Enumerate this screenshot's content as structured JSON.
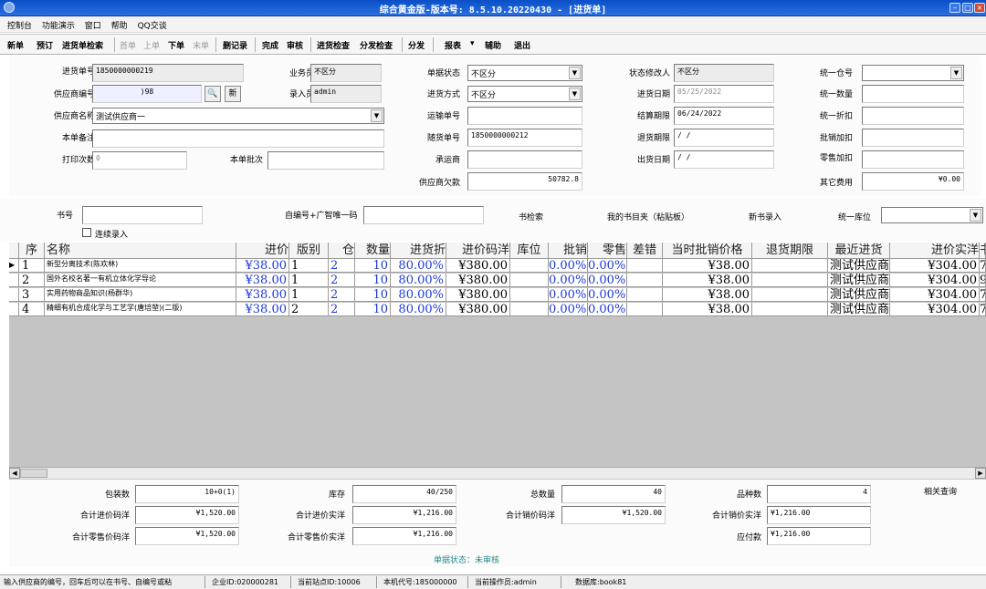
{
  "window": {
    "title": "综合黄金版-版本号: 8.5.10.20220430 - [进货单]"
  },
  "menu": [
    "控制台",
    "功能演示",
    "窗口",
    "帮助",
    "QQ交谈"
  ],
  "toolbar": {
    "new": "新单",
    "preorder": "预订",
    "search": "进货单检索",
    "first": "首单",
    "prev": "上单",
    "next": "下单",
    "last": "末单",
    "delete": "删记录",
    "finish": "完成",
    "review": "审核",
    "stock_check": "进货检查",
    "dist_check": "分发检查",
    "distribute": "分发",
    "report": "报表",
    "assist": "辅助",
    "exit": "退出"
  },
  "form": {
    "order_no_label": "进货单号",
    "order_no": "1850000000219",
    "supplier_code_label": "供应商编号",
    "supplier_code": ")98",
    "new_btn": "新",
    "supplier_name_label": "供应商名称",
    "supplier_name": "测试供应商一",
    "remark_label": "本单备注",
    "remark": "",
    "print_count_label": "打印次数",
    "print_count": "0",
    "batch_label": "本单批次",
    "batch": "",
    "clerk_label": "业务员",
    "clerk": "不区分",
    "entry_label": "录入员",
    "entry": "admin",
    "doc_status_label": "单据状态",
    "doc_status": "不区分",
    "method_label": "进货方式",
    "method": "不区分",
    "transport_no_label": "运输单号",
    "transport_no": "",
    "follow_no_label": "随货单号",
    "follow_no": "1850000000212",
    "carrier_label": "承运商",
    "carrier": "",
    "debt_label": "供应商欠款",
    "debt": "50782.8",
    "status_modifier_label": "状态修改人",
    "status_modifier": "不区分",
    "date_label": "进货日期",
    "date": "05/25/2022",
    "settle_label": "结算期限",
    "settle": "06/24/2022",
    "return_label": "退货期限",
    "return_val": "/ /",
    "ship_label": "出货日期",
    "ship": "/ /",
    "unified_store_label": "统一仓号",
    "unified_store": "",
    "unified_qty_label": "统一数量",
    "unified_qty": "",
    "unified_discount_label": "统一折扣",
    "unified_discount": "",
    "wholesale_add_label": "批销加扣",
    "wholesale_add": "",
    "retail_add_label": "零售加扣",
    "retail_add": "",
    "other_fee_label": "其它费用",
    "other_fee": "¥0.00"
  },
  "search_bar": {
    "book_no_label": "书号",
    "book_no": "",
    "continuous_label": "连续录入",
    "self_code_label": "自编号+广智唯一码",
    "self_code": "",
    "book_search": "书检索",
    "my_catalog": "我的书目夹（粘贴板）",
    "new_book": "新书录入",
    "unified_loc_label": "统一库位",
    "unified_loc": ""
  },
  "grid": {
    "columns": [
      "序",
      "名称",
      "进价",
      "版别",
      "仓",
      "数量",
      "进货折",
      "进价码洋",
      "库位",
      "批销",
      "零售",
      "差错",
      "当时批销价格",
      "退货期限",
      "最近进货",
      "进价实洋",
      "书"
    ],
    "rows": [
      {
        "no": "1",
        "name": "新型分离技术(陈欢林)",
        "price": "¥38.00",
        "ed": "1",
        "store": "2",
        "qty": "10",
        "disc": "80.00%",
        "code_amt": "¥380.00",
        "loc": "",
        "wholesale": "0.00%",
        "retail": "0.00%",
        "err": "",
        "then_price": "¥38.00",
        "return": "",
        "recent": "测试供应商一",
        "real_amt": "¥304.00",
        "extra": "7"
      },
      {
        "no": "2",
        "name": "国外名校名著一有机立体化学导论",
        "price": "¥38.00",
        "ed": "1",
        "store": "2",
        "qty": "10",
        "disc": "80.00%",
        "code_amt": "¥380.00",
        "loc": "",
        "wholesale": "0.00%",
        "retail": "0.00%",
        "err": "",
        "then_price": "¥38.00",
        "return": "",
        "recent": "测试供应商一",
        "real_amt": "¥304.00",
        "extra": "9"
      },
      {
        "no": "3",
        "name": "实用药物商品知识(杨群华)",
        "price": "¥38.00",
        "ed": "1",
        "store": "2",
        "qty": "10",
        "disc": "80.00%",
        "code_amt": "¥380.00",
        "loc": "",
        "wholesale": "0.00%",
        "retail": "0.00%",
        "err": "",
        "then_price": "¥38.00",
        "return": "",
        "recent": "测试供应商一",
        "real_amt": "¥304.00",
        "extra": "7"
      },
      {
        "no": "4",
        "name": "精细有机合成化学与工艺学(唐培堃)(二版)",
        "price": "¥38.00",
        "ed": "2",
        "store": "2",
        "qty": "10",
        "disc": "80.00%",
        "code_amt": "¥380.00",
        "loc": "",
        "wholesale": "0.00%",
        "retail": "0.00%",
        "err": "",
        "then_price": "¥38.00",
        "return": "",
        "recent": "测试供应商一",
        "real_amt": "¥304.00",
        "extra": "7"
      }
    ]
  },
  "summary": {
    "pack_label": "包装数",
    "pack": "10+0(1)",
    "stock_label": "库存",
    "stock": "40/250",
    "total_qty_label": "总数量",
    "total_qty": "40",
    "kinds_label": "品种数",
    "kinds": "4",
    "related_query": "相关查询",
    "buy_code_label": "合计进价码洋",
    "buy_code": "¥1,520.00",
    "buy_real_label": "合计进价实洋",
    "buy_real": "¥1,216.00",
    "sale_code_label": "合计销价码洋",
    "sale_code": "¥1,520.00",
    "sale_real_label": "合计销价实洋",
    "sale_real": "¥1,216.00",
    "retail_code_label": "合计零售价码洋",
    "retail_code": "¥1,520.00",
    "retail_real_label": "合计零售价实洋",
    "retail_real": "¥1,216.00",
    "payable_label": "应付款",
    "payable": "¥1,216.00",
    "doc_state": "单据状态：未审核"
  },
  "statusbar": {
    "hint": "输入供应商的编号，回车后可以在书号、自编号或粘",
    "company": "企业ID:020000281",
    "site": "当前站点ID:10006",
    "machine": "本机代号:185000000",
    "operator": "当前操作员:admin",
    "db": "数据库:book81"
  }
}
